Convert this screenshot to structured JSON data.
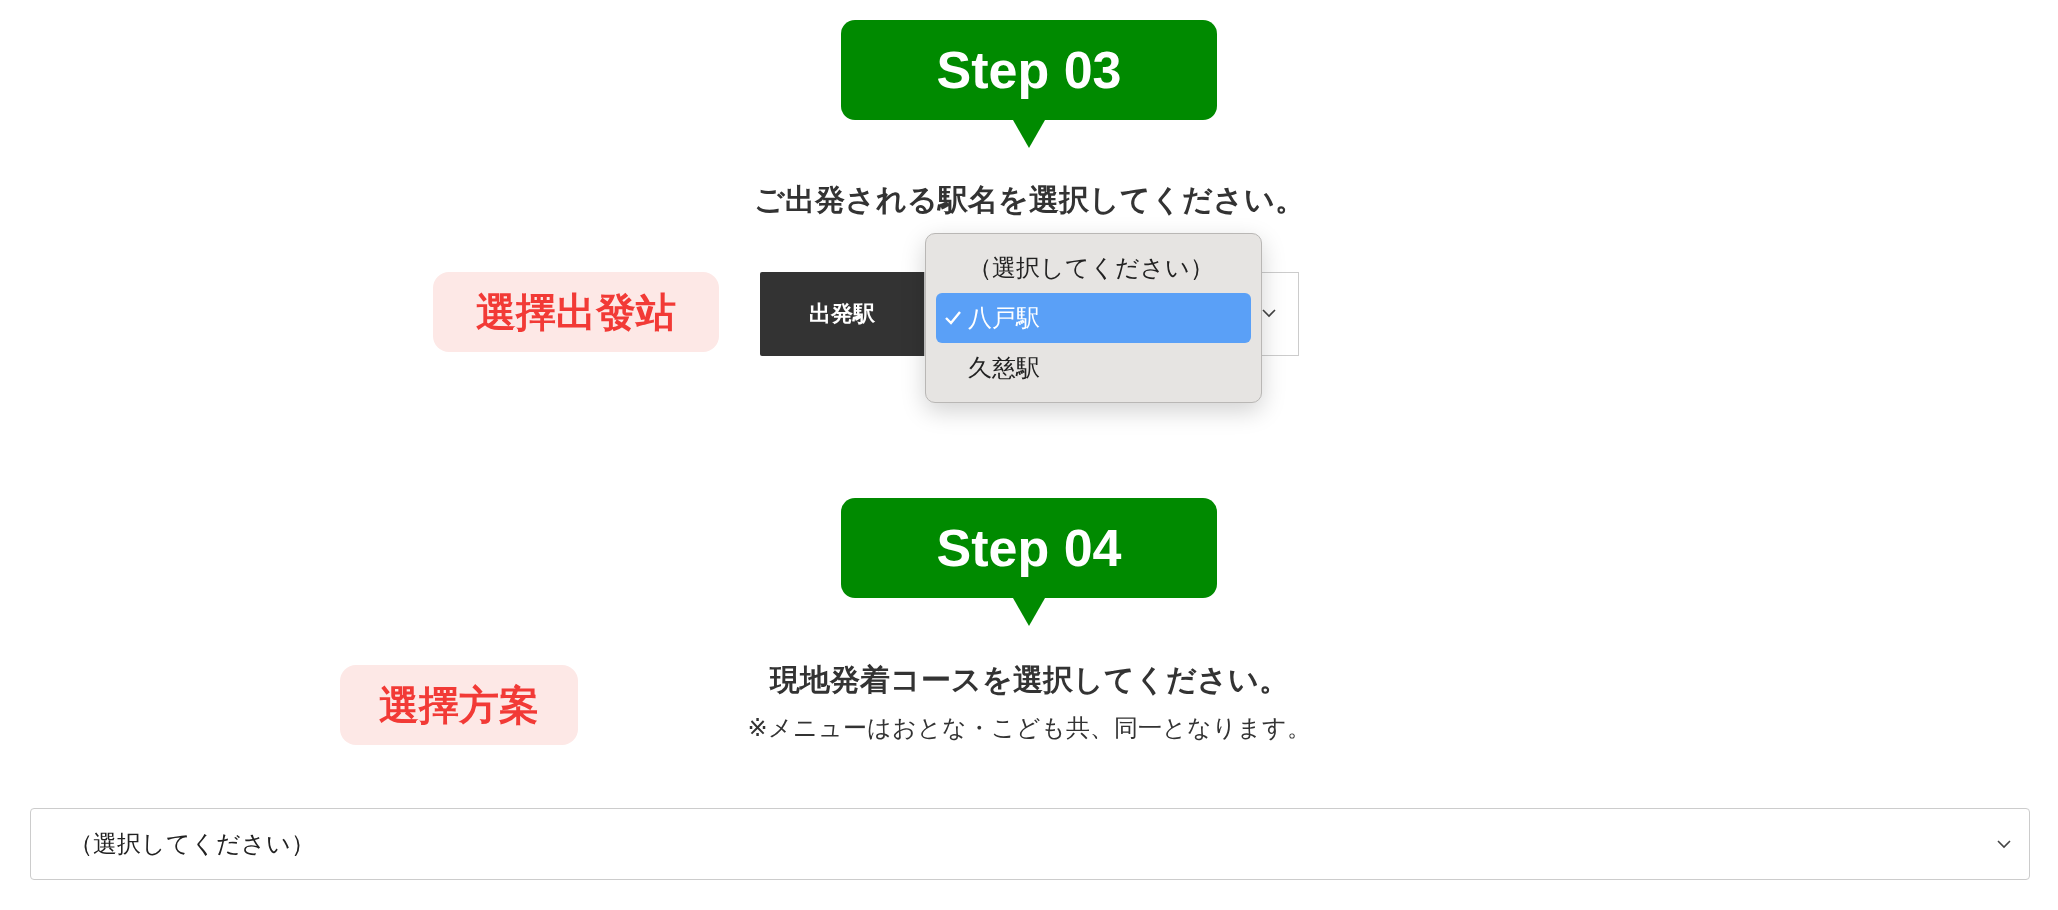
{
  "step03": {
    "badge": "Step 03",
    "heading": "ご出発される駅名を選択してください。",
    "annotation": "選擇出發站",
    "station_select": {
      "label": "出発駅",
      "expanded": true,
      "options": [
        {
          "label": "（選択してください）",
          "selected": false
        },
        {
          "label": "八戸駅",
          "selected": true
        },
        {
          "label": "久慈駅",
          "selected": false
        }
      ]
    }
  },
  "step04": {
    "badge": "Step 04",
    "heading": "現地発着コースを選択してください。",
    "note": "※メニューはおとな・こども共、同一となります。",
    "annotation": "選擇方案",
    "course_select": {
      "value": "（選択してください）"
    }
  }
}
